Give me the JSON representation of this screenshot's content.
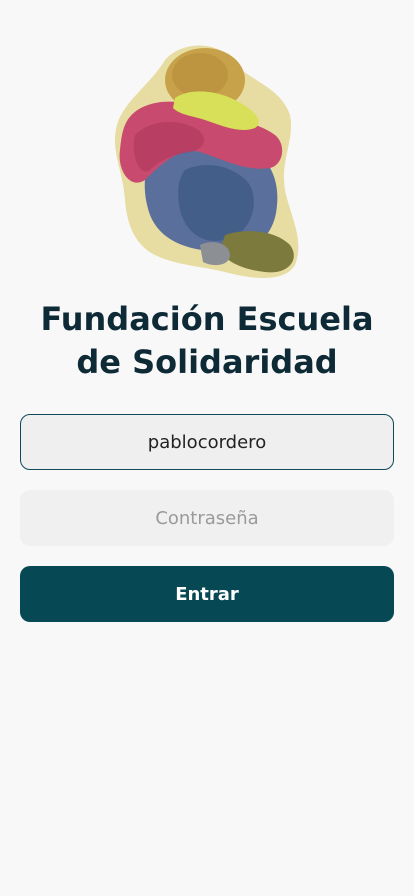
{
  "app": {
    "title_line_1": "Fundación Escuela",
    "title_line_2": "de Solidaridad",
    "logo_icon": "watercolor-child-illustration"
  },
  "login": {
    "username_value": "pablocordero",
    "password_placeholder": "Contraseña",
    "submit_label": "Entrar"
  },
  "colors": {
    "background": "#f8f8f8",
    "title": "#0e2a36",
    "accent": "#074855",
    "input_bg": "#efefef"
  }
}
